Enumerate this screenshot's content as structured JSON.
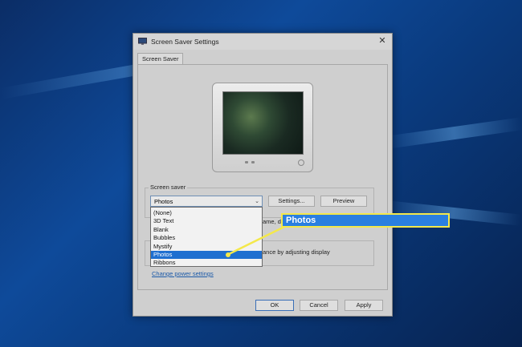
{
  "window": {
    "title": "Screen Saver Settings",
    "close_glyph": "✕"
  },
  "tabs": [
    "Screen Saver"
  ],
  "screen_saver_group": {
    "label": "Screen saver",
    "selected": "Photos",
    "options": [
      "(None)",
      "3D Text",
      "Blank",
      "Bubbles",
      "Mystify",
      "Photos",
      "Ribbons"
    ],
    "settings_button": "Settings...",
    "preview_button": "Preview",
    "obscured_wait_text": "ame, d",
    "obscured_power_text": "ance by adjusting display"
  },
  "power": {
    "link": "Change power settings"
  },
  "footer": {
    "ok": "OK",
    "cancel": "Cancel",
    "apply": "Apply"
  },
  "callout": {
    "text": "Photos"
  },
  "colors": {
    "accent_selected": "#1f6fd0",
    "callout_border": "#f4e84a",
    "callout_fill": "#2a7fe0"
  },
  "icons": {
    "title": "screen-saver-icon",
    "close": "close-icon",
    "dropdown": "chevron-down-icon"
  }
}
